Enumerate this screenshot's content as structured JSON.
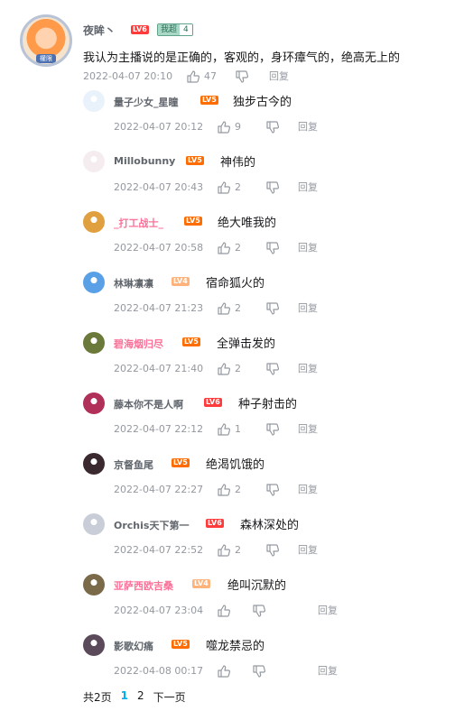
{
  "root": {
    "username": "夜眸丶",
    "level": "LV6",
    "medal_name": "我超",
    "medal_level": "4",
    "avatar_tag": "權限",
    "content": "我认为主播说的是正确的，客观的，身环瘴气的，绝高无上的",
    "time": "2022-04-07 20:10",
    "likes": "47",
    "reply_label": "回复"
  },
  "replies": [
    {
      "username": "量子少女_星瞳",
      "level": "LV5",
      "text": "独步古今的",
      "time": "2022-04-07 20:12",
      "likes": "9",
      "avatar_color": "#e9f1fb"
    },
    {
      "username": "Millobunny",
      "level": "LV5",
      "text": "神伟的",
      "time": "2022-04-07 20:43",
      "likes": "2",
      "avatar_color": "#f4ecef"
    },
    {
      "username": "_打工战士_",
      "level": "LV5",
      "text": "绝大唯我的",
      "time": "2022-04-07 20:58",
      "likes": "2",
      "avatar_color": "#e0a040",
      "vip": true
    },
    {
      "username": "林琳凛凛",
      "level": "LV4",
      "text": "宿命狐火的",
      "time": "2022-04-07 21:23",
      "likes": "2",
      "avatar_color": "#5aa0e6"
    },
    {
      "username": "碧海烟归尽",
      "level": "LV5",
      "text": "全弹击发的",
      "time": "2022-04-07 21:40",
      "likes": "2",
      "avatar_color": "#6b7a3a",
      "vip": true
    },
    {
      "username": "藤本你不是人啊",
      "level": "LV6",
      "text": "种子射击的",
      "time": "2022-04-07 22:12",
      "likes": "1",
      "avatar_color": "#b0305a"
    },
    {
      "username": "京督鱼尾",
      "level": "LV5",
      "text": "绝渴饥饿的",
      "time": "2022-04-07 22:27",
      "likes": "2",
      "avatar_color": "#3a2a30"
    },
    {
      "username": "Orchis天下第一",
      "level": "LV6",
      "text": "森林深处的",
      "time": "2022-04-07 22:52",
      "likes": "2",
      "avatar_color": "#c8cdd8"
    },
    {
      "username": "亚萨西欧吉桑",
      "level": "LV4",
      "text": "绝叫沉默的",
      "time": "2022-04-07 23:04",
      "likes": "",
      "avatar_color": "#7a6a4a",
      "vip": true
    },
    {
      "username": "影歌幻痛",
      "level": "LV5",
      "text": "噬龙禁忌的",
      "time": "2022-04-08 00:17",
      "likes": "",
      "avatar_color": "#5a4a5a"
    }
  ],
  "reply_label": "回复",
  "pager": {
    "total": "共2页",
    "page1": "1",
    "page2": "2",
    "next": "下一页"
  },
  "colors": {
    "vip_name": "#fb7299",
    "lv6": "#ff3b3b",
    "lv5": "#ff6c00",
    "lv4": "#ffb37c",
    "current_page": "#00aeec"
  }
}
